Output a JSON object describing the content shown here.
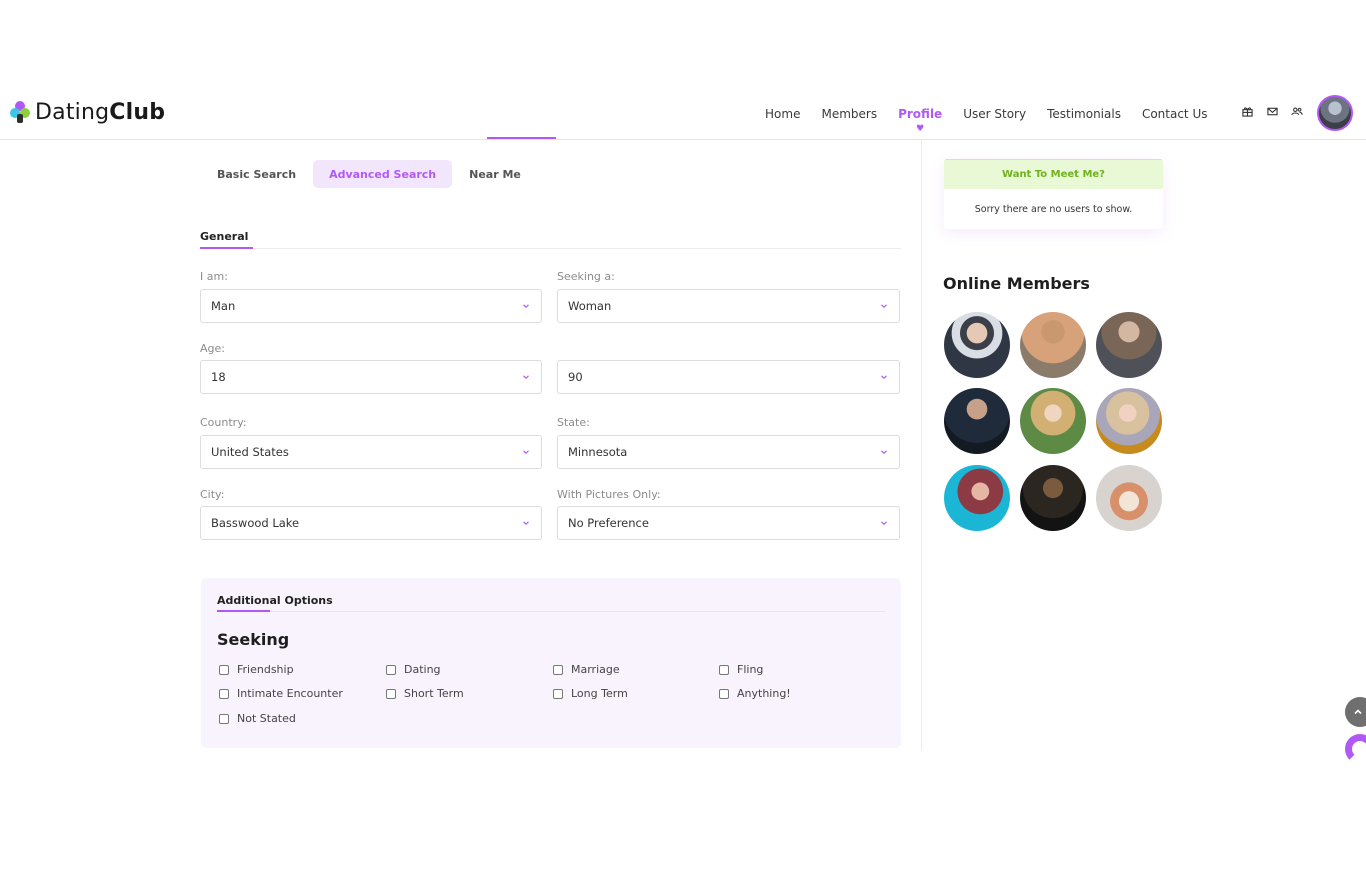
{
  "brand": {
    "name_light": "Dating",
    "name_bold": "Club"
  },
  "nav": {
    "items": [
      {
        "label": "Home",
        "active": false
      },
      {
        "label": "Members",
        "active": false
      },
      {
        "label": "Profile",
        "active": true
      },
      {
        "label": "User Story",
        "active": false
      },
      {
        "label": "Testimonials",
        "active": false
      },
      {
        "label": "Contact Us",
        "active": false
      }
    ],
    "icons": [
      "gift-icon",
      "mail-icon",
      "users-icon"
    ],
    "accent_color": "#b259f5"
  },
  "search_tabs": [
    {
      "label": "Basic Search",
      "active": false
    },
    {
      "label": "Advanced Search",
      "active": true
    },
    {
      "label": "Near Me",
      "active": false
    }
  ],
  "general": {
    "title": "General",
    "i_am": {
      "label": "I am:",
      "value": "Man"
    },
    "seeking_a": {
      "label": "Seeking a:",
      "value": "Woman"
    },
    "age": {
      "label": "Age:",
      "min": "18",
      "max": "90"
    },
    "country": {
      "label": "Country:",
      "value": "United States"
    },
    "state": {
      "label": "State:",
      "value": "Minnesota"
    },
    "city": {
      "label": "City:",
      "value": "Basswood Lake"
    },
    "pictures": {
      "label": "With Pictures Only:",
      "value": "No Preference"
    }
  },
  "additional": {
    "title": "Additional Options",
    "seeking_heading": "Seeking",
    "options": [
      "Friendship",
      "Dating",
      "Marriage",
      "Fling",
      "Intimate Encounter",
      "Short Term",
      "Long Term",
      "Anything!",
      "Not Stated"
    ]
  },
  "sidebar": {
    "meet": {
      "title": "Want To Meet Me?",
      "empty": "Sorry there are no users to show."
    },
    "online_title": "Online Members",
    "member_count": 9
  }
}
